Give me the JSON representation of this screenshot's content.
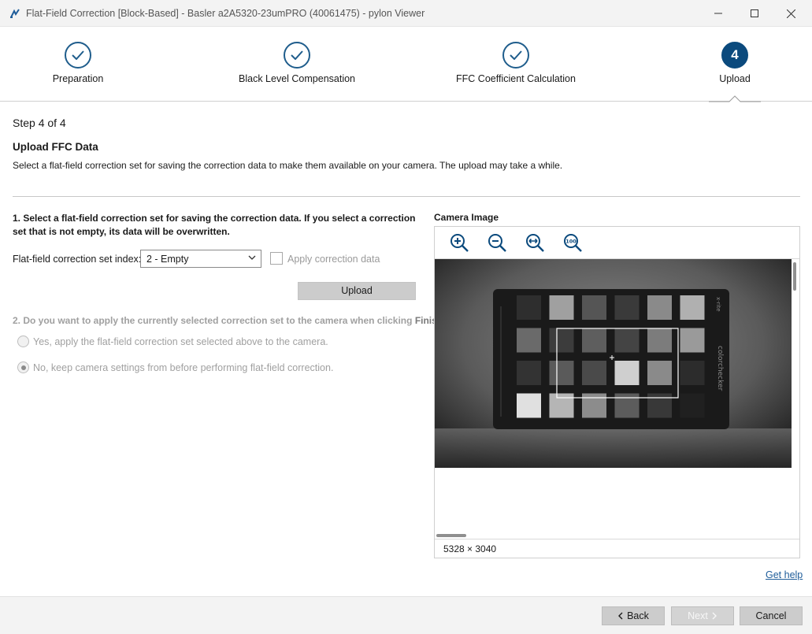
{
  "window": {
    "title": "Flat-Field Correction [Block-Based] - Basler a2A5320-23umPRO (40061475) - pylon Viewer"
  },
  "stepper": {
    "steps": [
      {
        "label": "Preparation",
        "state": "done"
      },
      {
        "label": "Black Level Compensation",
        "state": "done"
      },
      {
        "label": "FFC Coefficient Calculation",
        "state": "done"
      },
      {
        "label": "Upload",
        "state": "active",
        "number": "4"
      }
    ]
  },
  "content": {
    "step_count": "Step 4 of 4",
    "title": "Upload FFC Data",
    "description": "Select a flat-field correction set for saving the correction data to make them available on your camera. The upload may take a while."
  },
  "section1": {
    "question": "1. Select a flat-field correction set for saving the correction data. If you select a correction set that is not empty, its data will be overwritten.",
    "index_label": "Flat-field correction set index:",
    "index_value": "2 - Empty",
    "apply_label": "Apply correction data",
    "apply_checked": false,
    "upload_button": "Upload"
  },
  "section2": {
    "question_prefix": "2. Do you want to apply the currently selected correction set to the camera when clicking ",
    "question_bold": "Finish",
    "question_suffix": "?",
    "option_yes": "Yes, apply the flat-field correction set selected above to the camera.",
    "option_no": "No, keep camera settings from before performing flat-field correction.",
    "selected": "no"
  },
  "camera": {
    "title": "Camera Image",
    "resolution": "5328 × 3040",
    "chart_text": "colorchecker",
    "brand_text": "x-rite"
  },
  "links": {
    "help": "Get help"
  },
  "footer": {
    "back": "Back",
    "next": "Next",
    "cancel": "Cancel"
  },
  "colors": {
    "accent": "#0b4a7d",
    "step_border": "#1f5d8c",
    "link": "#1f5d9a"
  }
}
